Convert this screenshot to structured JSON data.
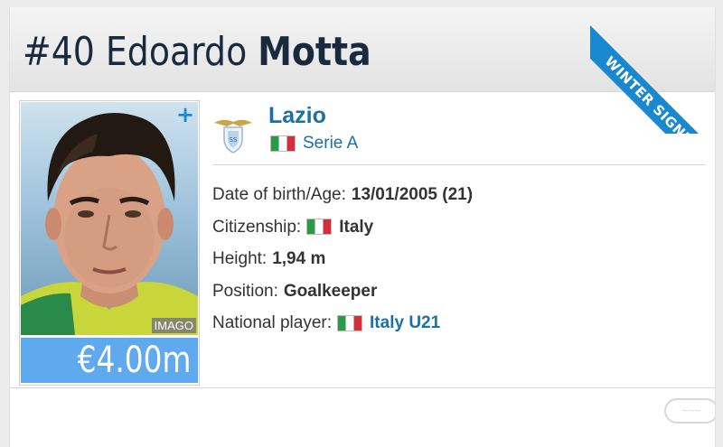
{
  "header": {
    "number": "#40",
    "first_name": "Edoardo",
    "last_name": "Motta",
    "ribbon": "WINTER SIGNING"
  },
  "photo": {
    "credit": "IMAGO",
    "expand_icon": "plus-icon"
  },
  "market_value": "€4.00m",
  "club": {
    "name": "Lazio",
    "league": "Serie A",
    "league_flag": "italy-flag"
  },
  "info": {
    "birth_label": "Date of birth/Age:",
    "birth_value": "13/01/2005 (21)",
    "citizenship_label": "Citizenship:",
    "citizenship_value": "Italy",
    "height_label": "Height:",
    "height_value": "1,94 m",
    "position_label": "Position:",
    "position_value": "Goalkeeper",
    "national_label": "National player:",
    "national_value": "Italy U21"
  },
  "colors": {
    "accent": "#1d6fa6",
    "ribbon": "#1a88d0",
    "value_bg": "#5fa9ee",
    "title": "#1a2a3e"
  }
}
